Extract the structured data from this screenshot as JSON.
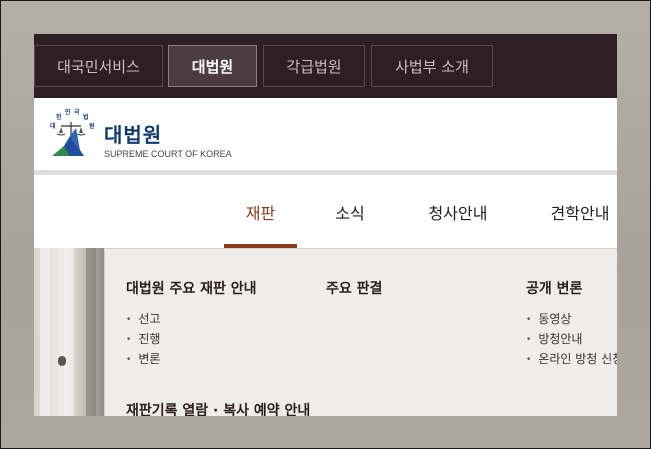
{
  "top_nav": {
    "items": [
      {
        "label": "대국민서비스",
        "active": false
      },
      {
        "label": "대법원",
        "active": true
      },
      {
        "label": "각급법원",
        "active": false
      },
      {
        "label": "사법부 소개",
        "active": false
      }
    ]
  },
  "logo": {
    "title": "대법원",
    "subtitle": "SUPREME COURT OF KOREA",
    "emblem_text": "대한민국법원"
  },
  "main_menu": {
    "items": [
      {
        "label": "재판",
        "active": true
      },
      {
        "label": "소식",
        "active": false
      },
      {
        "label": "청사안내",
        "active": false
      },
      {
        "label": "견학안내",
        "active": false
      }
    ]
  },
  "dropdown": {
    "columns": [
      {
        "title": "대법원 주요 재판 안내",
        "links": [
          "선고",
          "진행",
          "변론"
        ]
      },
      {
        "title": "주요 판결",
        "links": []
      },
      {
        "title": "공개 변론",
        "links": [
          "동영상",
          "방청안내",
          "온라인 방청 신청"
        ]
      }
    ],
    "bottom_title": "재판기록 열람 · 복사 예약 안내"
  },
  "colors": {
    "topbar": "#2d1f24",
    "accent": "#8b3a1b",
    "logo_blue": "#0f3b6e",
    "dropdown_bg": "#efede7"
  }
}
